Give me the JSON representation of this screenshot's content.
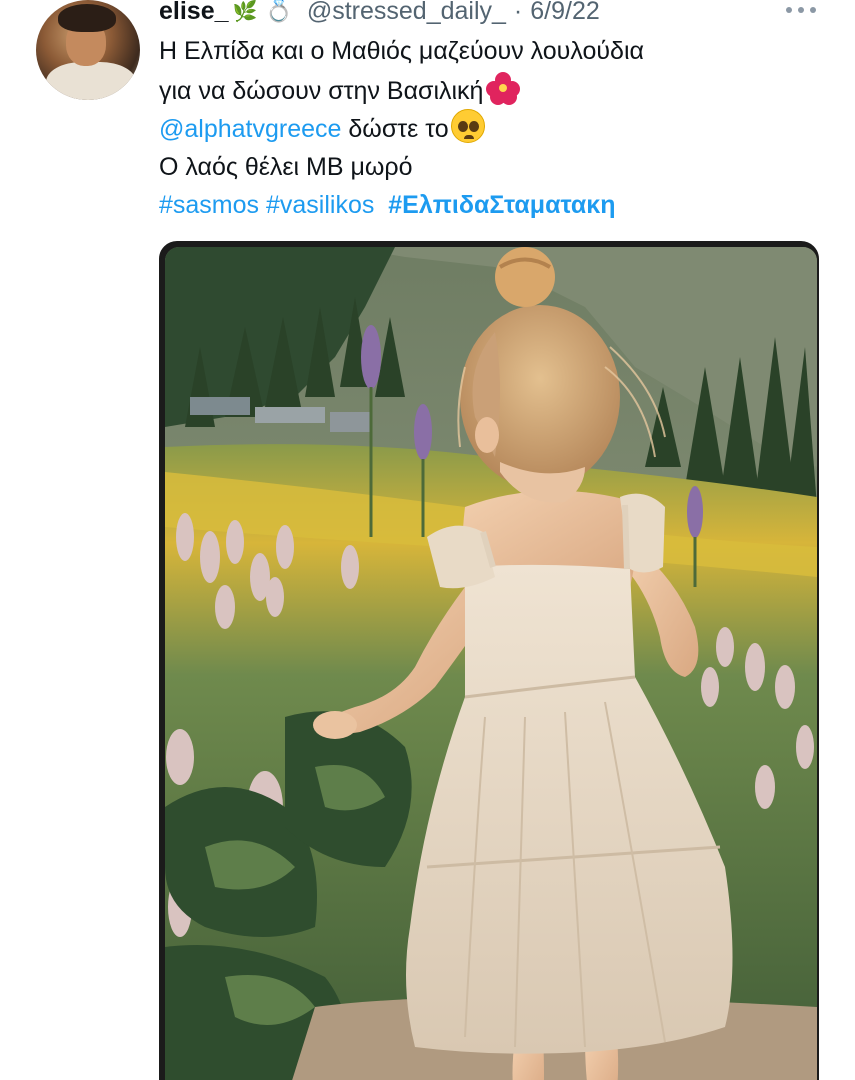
{
  "tweet": {
    "display_name": "elise_",
    "name_emoji": "🌿",
    "ring_symbol": "💍",
    "handle": "@stressed_daily_",
    "separator": "·",
    "date": "6/9/22",
    "more_icon": "more-dots-icon",
    "lines": {
      "line1": "Η Ελπίδα και ο Μαθιός μαζεύουν λουλούδια",
      "line2": "για να δώσουν στην Βασιλική",
      "line3_mention": "@alphatvgreece",
      "line3_text": " δώστε το",
      "line4": "Ο λαός θέλει ΜΒ μωρό"
    },
    "hashtags": {
      "tag1": "#sasmos",
      "tag2": "#vasilikos",
      "tag3": "#ΕλπιδαΣταματακη"
    },
    "emojis": {
      "hibiscus": "hibiscus-emoji",
      "pleading": "pleading-face-emoji"
    },
    "media": {
      "type": "photo",
      "subject": "child-in-flower-field"
    },
    "colors": {
      "link": "#1d9bf0",
      "text": "#0f1419",
      "secondary": "#536471"
    }
  }
}
